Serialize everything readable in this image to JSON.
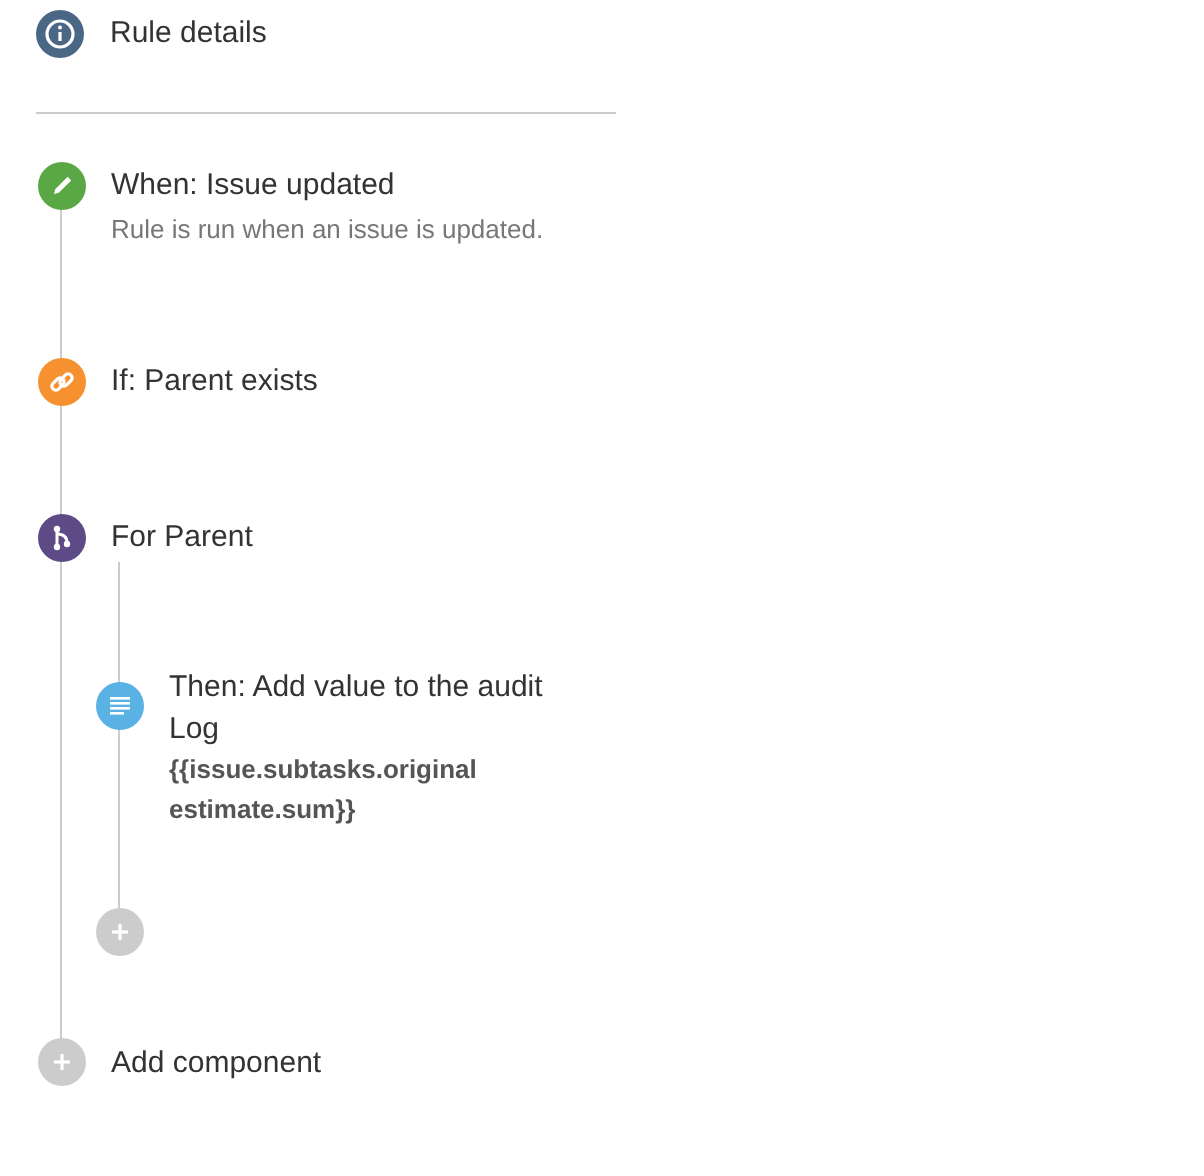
{
  "rule_details": {
    "label": "Rule details"
  },
  "steps": [
    {
      "kind": "trigger",
      "title": "When: Issue updated",
      "description": "Rule is run when an issue is updated."
    },
    {
      "kind": "condition",
      "title": "If: Parent exists"
    },
    {
      "kind": "branch",
      "title": "For Parent",
      "children": [
        {
          "kind": "action",
          "title": "Then: Add value to the audit Log",
          "detail": "{{issue.subtasks.original estimate.sum}}"
        },
        {
          "kind": "add"
        }
      ]
    },
    {
      "kind": "add",
      "label": "Add component"
    }
  ]
}
